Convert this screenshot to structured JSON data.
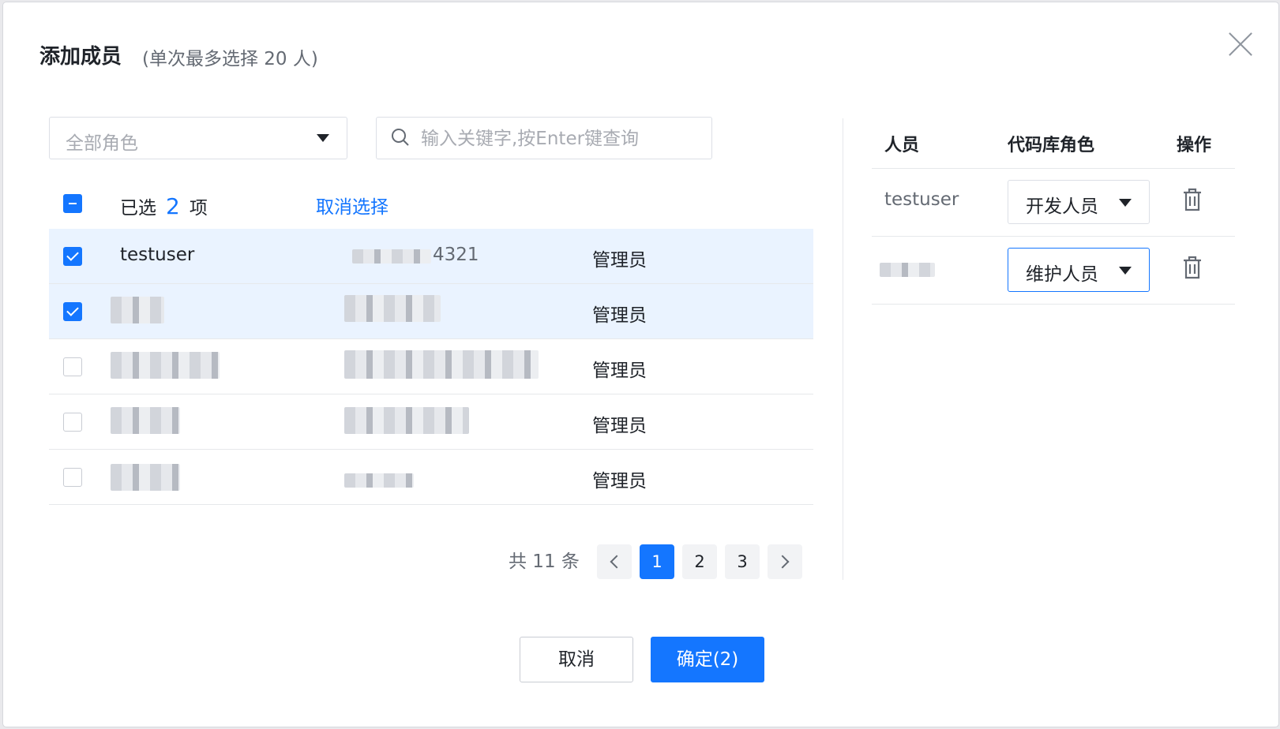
{
  "dialog": {
    "title": "添加成员",
    "subtitle": "(单次最多选择 20 人)"
  },
  "filters": {
    "role_select_placeholder": "全部角色",
    "search_placeholder": "输入关键字,按Enter键查询"
  },
  "selection": {
    "prefix": "已选",
    "count": "2",
    "suffix": "项",
    "clear_label": "取消选择"
  },
  "rows": [
    {
      "name": "testuser",
      "account": "4321",
      "role": "管理员",
      "checked": true
    },
    {
      "name": "",
      "account": "",
      "role": "管理员",
      "checked": true
    },
    {
      "name": "",
      "account": "",
      "role": "管理员",
      "checked": false
    },
    {
      "name": "",
      "account": "",
      "role": "管理员",
      "checked": false
    },
    {
      "name": "",
      "account": "",
      "role": "管理员",
      "checked": false
    }
  ],
  "pagination": {
    "total_label": "共 11 条",
    "pages": [
      "1",
      "2",
      "3"
    ],
    "current": "1"
  },
  "selected_panel": {
    "headers": {
      "user": "人员",
      "role": "代码库角色",
      "action": "操作"
    },
    "items": [
      {
        "user": "testuser",
        "role": "开发人员"
      },
      {
        "user": "",
        "role": "维护人员"
      }
    ]
  },
  "footer": {
    "cancel_label": "取消",
    "confirm_label": "确定(2)"
  },
  "colors": {
    "accent": "#1476ff",
    "row_selected": "#eaf3ff"
  }
}
